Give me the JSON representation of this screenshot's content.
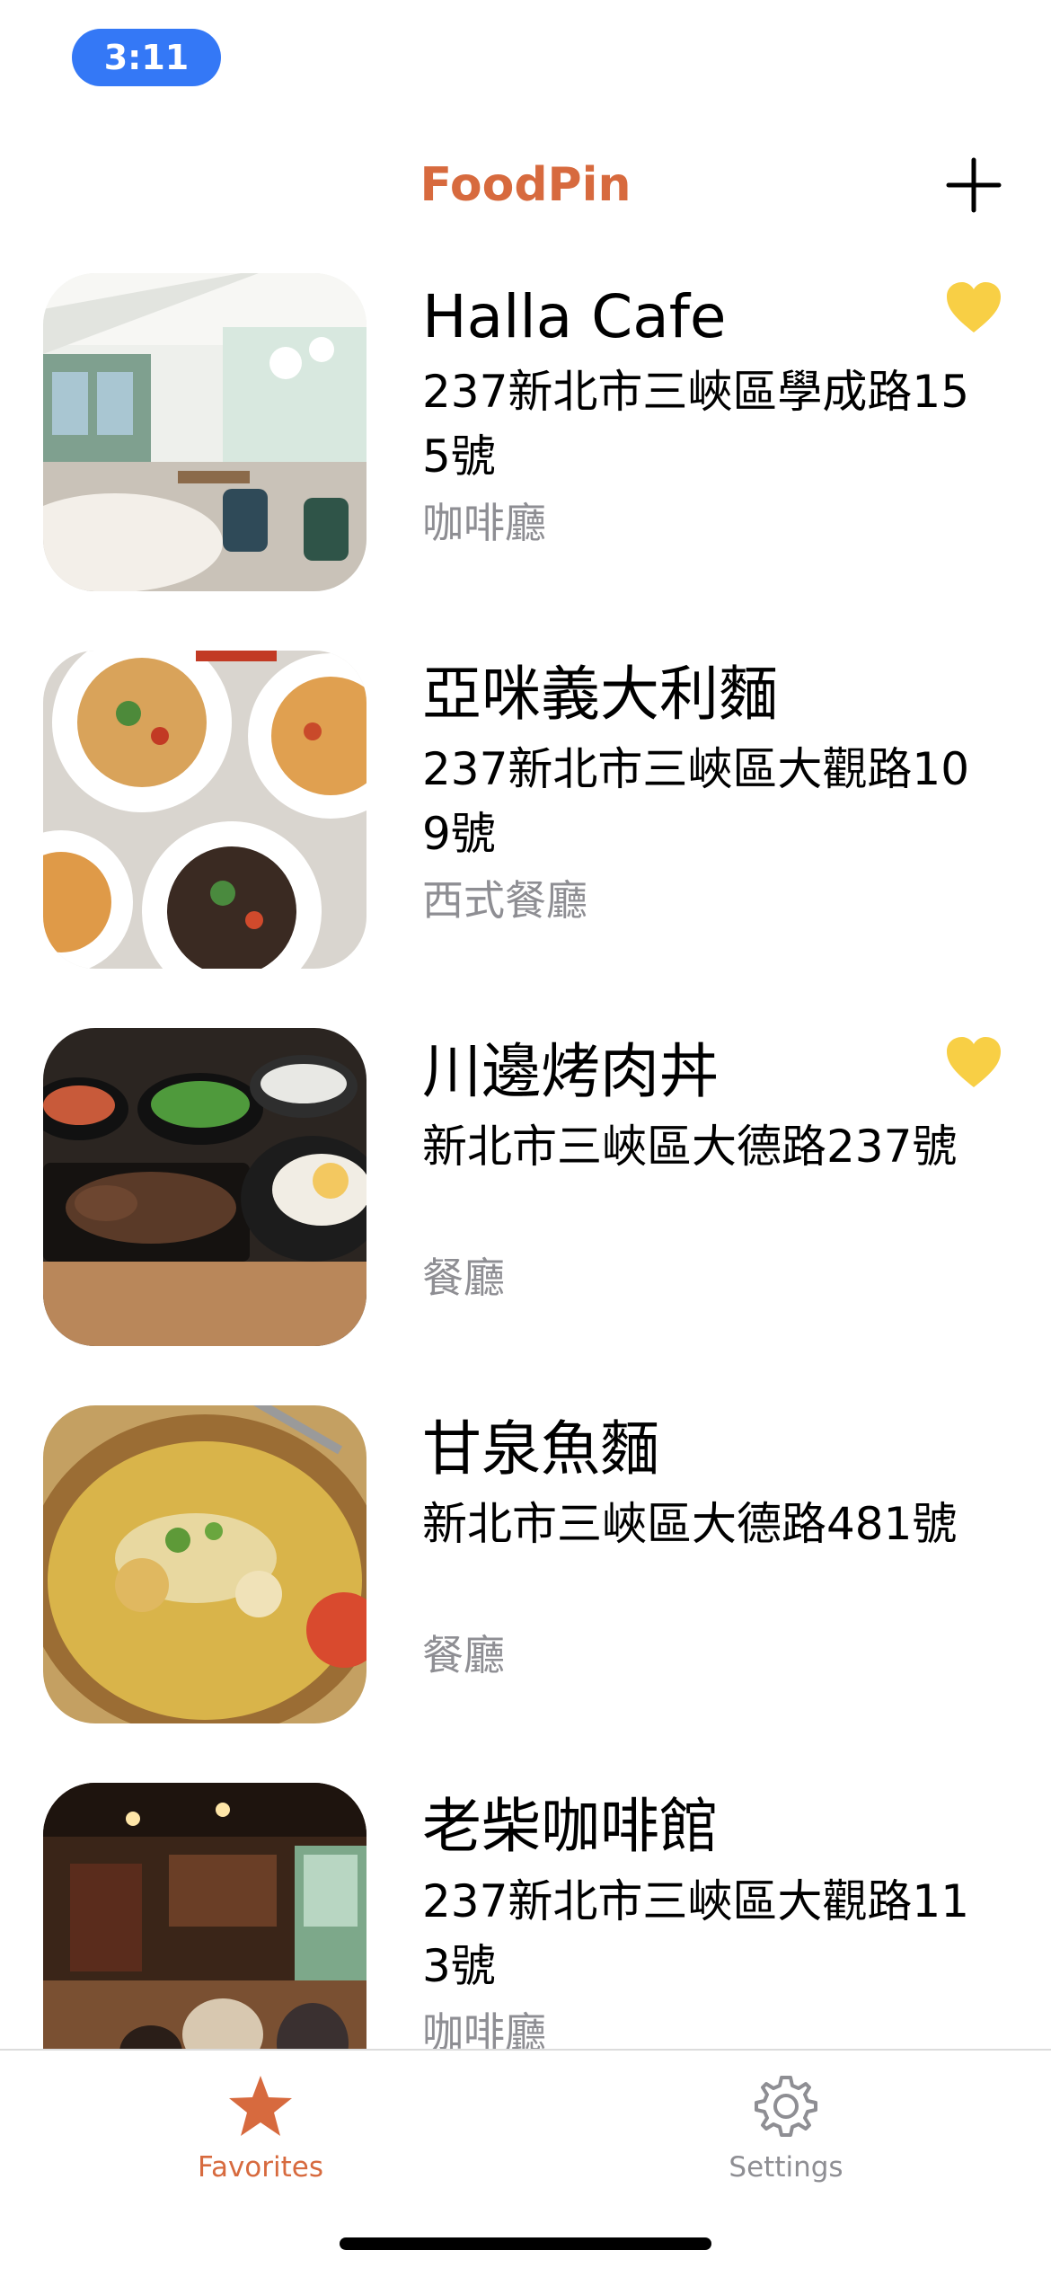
{
  "status_bar": {
    "time": "3:11"
  },
  "colors": {
    "accent": "#d76a3e",
    "heart": "#f8cf45",
    "secondary_text": "#8e8e93",
    "tab_inactive": "#8e8e93",
    "status_pill": "#3478f6"
  },
  "nav": {
    "title": "FoodPin",
    "add_icon": "plus-icon"
  },
  "restaurants": [
    {
      "name": "Halla Cafe",
      "address": "237新北市三峽區學成路155號",
      "type": "咖啡廳",
      "favorite": true
    },
    {
      "name": "亞咪義大利麵",
      "address": "237新北市三峽區大觀路109號",
      "type": "西式餐廳",
      "favorite": false
    },
    {
      "name": "川邊烤肉丼",
      "address": "新北市三峽區大德路237號",
      "type": "餐廳",
      "favorite": true
    },
    {
      "name": "甘泉魚麵",
      "address": "新北市三峽區大德路481號",
      "type": "餐廳",
      "favorite": false
    },
    {
      "name": "老柴咖啡館",
      "address": "237新北市三峽區大觀路113號",
      "type": "咖啡廳",
      "favorite": false
    }
  ],
  "tab_bar": {
    "tabs": [
      {
        "label": "Favorites",
        "icon": "star-icon",
        "selected": true
      },
      {
        "label": "Settings",
        "icon": "gear-icon",
        "selected": false
      }
    ]
  }
}
